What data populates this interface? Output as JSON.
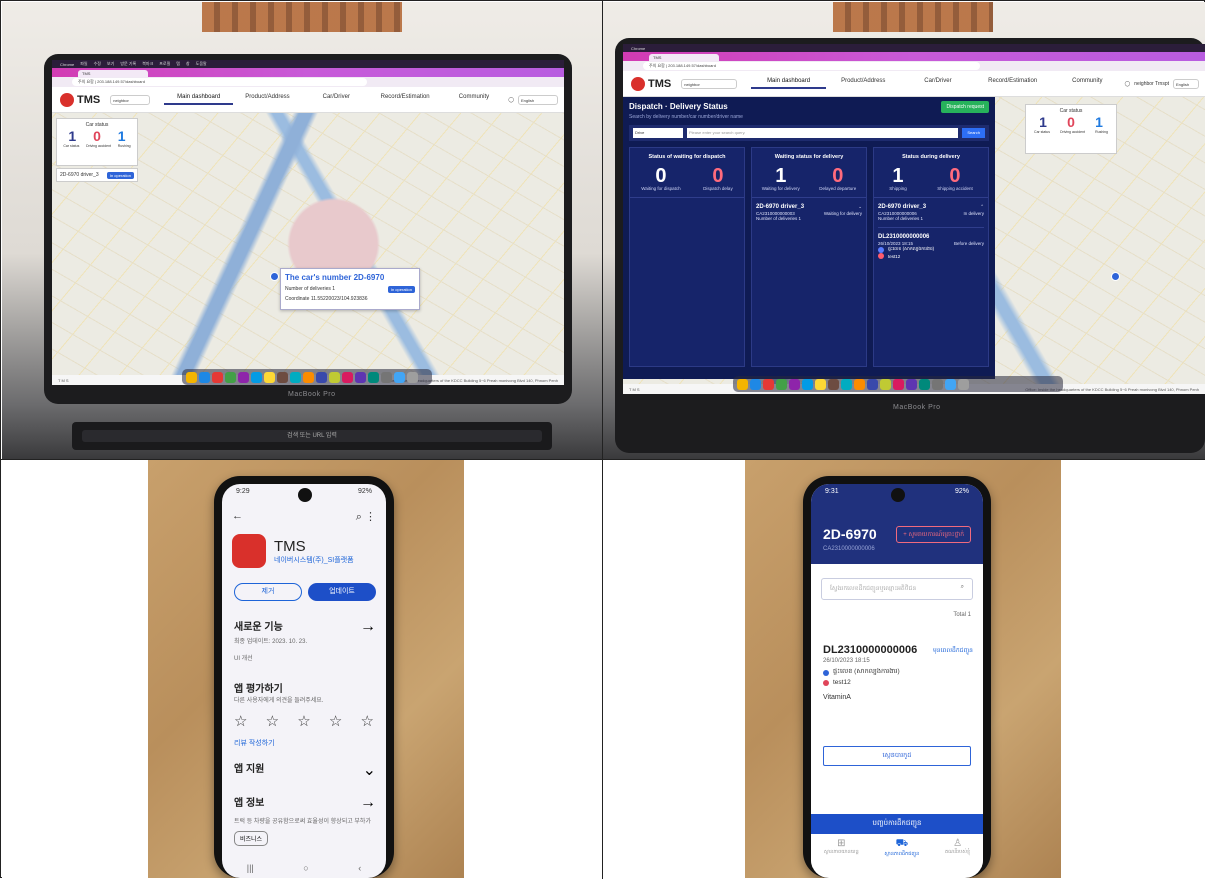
{
  "top_left": {
    "menubar": [
      "Chrome",
      "파일",
      "수정",
      "보기",
      "방문 기록",
      "북마크",
      "프로필",
      "탭",
      "창",
      "도움말"
    ],
    "tab_title": "TMS",
    "url": "주의 요함 | 203.188.149.57/dashboard",
    "header": {
      "logo": "TMS",
      "dropdown": "neighbor",
      "nav": [
        "Main dashboard",
        "Product/Address",
        "Car/Driver",
        "Record/Estimation",
        "Community"
      ],
      "active_nav": "Main dashboard",
      "lang": "English"
    },
    "car_status": {
      "title": "Car status",
      "values": [
        "1",
        "0",
        "1"
      ],
      "labels": [
        "Car status",
        "Driving accident",
        "Rushing"
      ],
      "driver": "2D-6970 driver_3",
      "driver_badge": "In operation"
    },
    "popup": {
      "title": "The car's number 2D-6970",
      "line1": "Number of deliveries 1",
      "badge": "In operation",
      "line2": "Coordinate 11.55220023/104.923836"
    },
    "footer_left": "T M S",
    "footer_right": "Office: Inside the headquarters of the KDCC Building 5~6 Preah monivong Blvd 140, Phnom Penh",
    "macbook": "MacBook Pro",
    "touchbar": "검색 또는 URL 입력"
  },
  "top_right": {
    "tab_title": "TMS",
    "url": "주의 요함 | 203.188.149.57/dashboard",
    "header": {
      "logo": "TMS",
      "dropdown": "neighbor",
      "nav": [
        "Main dashboard",
        "Product/Address",
        "Car/Driver",
        "Record/Estimation",
        "Community"
      ],
      "user": "neighbor Trnspt",
      "lang": "English"
    },
    "dispatch": {
      "title": "Dispatch · Delivery Status",
      "subtitle": "Search by delivery number/car number/driver name",
      "request_button": "Dispatch request",
      "search_select": "Drive",
      "search_placeholder": "Please enter your search query.",
      "search_button": "Search",
      "columns": [
        {
          "title": "Status of waiting for dispatch",
          "a": "0",
          "a_label": "Waiting for dispatch",
          "b": "0",
          "b_label": "Dispatch delay"
        },
        {
          "title": "Waiting status for delivery",
          "a": "1",
          "a_label": "Waiting for delivery",
          "b": "0",
          "b_label": "Delayed departure"
        },
        {
          "title": "Status during delivery",
          "a": "1",
          "a_label": "Shipping",
          "b": "0",
          "b_label": "Shipping accident"
        }
      ],
      "card_wait": {
        "driver": "2D-6970 driver_3",
        "code": "CA2310000000003",
        "status": "Waiting for delivery",
        "deliveries": "Number of deliveries 1"
      },
      "card_ship": {
        "driver": "2D-6970 driver_3",
        "code": "CA2310000000006",
        "status": "In delivery",
        "deliveries": "Number of deliveries 1",
        "dl": "DL2310000000006",
        "date": "26/10/2023 18:15",
        "dl_status": "Before delivery",
        "from": "ផ្ទះលេខ (សាកល្បងការងារ)",
        "to": "test12"
      }
    },
    "car_status": {
      "title": "Car status",
      "values": [
        "1",
        "0",
        "1"
      ],
      "labels": [
        "Car status",
        "Driving accident",
        "Rushing"
      ]
    },
    "footer_left": "T M S",
    "footer_right": "Office: Inside the headquarters of the KDCC Building 5~6 Preah monivong Blvd 140, Phnom Penh",
    "macbook": "MacBook Pro"
  },
  "bottom_left": {
    "status_time": "9:29",
    "status_right": "92%",
    "app_name": "TMS",
    "developer": "네이버시스템(주)_SI플랫폼",
    "btn_uninstall": "제거",
    "btn_update": "업데이트",
    "whats_new": "새로운 기능",
    "last_updated": "최종 업데이트: 2023. 10. 23.",
    "update_note": "UI 개선",
    "rate_title": "앱 평가하기",
    "rate_sub": "다른 사용자에게 의견을 들려주세요.",
    "write_review": "리뷰 작성하기",
    "app_support": "앱 지원",
    "about_app": "앱 정보",
    "about_text": "트럭 등 차량을 공유함으로써 효율성이 향상되고 부하가",
    "tag": "비즈니스"
  },
  "bottom_right": {
    "status_time": "9:31",
    "status_right": "92%",
    "plate": "2D-6970",
    "code": "CA2310000000006",
    "report_btn": "+ សូមរាយការណ៍គ្រោះថ្នាក់",
    "search_placeholder": "ស្វែងរកលេខដឹកជញ្ជូនឬឈ្មោះអតិថិជន",
    "total": "Total 1",
    "dl_no": "DL2310000000006",
    "dl_status": "មុនពេលដឹកជញ្ជូន",
    "date": "26/10/2023 18:15",
    "from": "ផ្ទះលេខ (សាកល្បងការងារ)",
    "to": "test12",
    "product": "VitaminA",
    "outline_btn": "ស្កេនបារកូដ",
    "bottom_btn": "បញ្ចប់ការដឹកជញ្ជូន",
    "tabs": [
      "ស្ថានភាពយានយន្ត",
      "ស្ថានភាពដឹកជញ្ជូន",
      "គណនីរបស់ខ្ញុំ"
    ]
  }
}
